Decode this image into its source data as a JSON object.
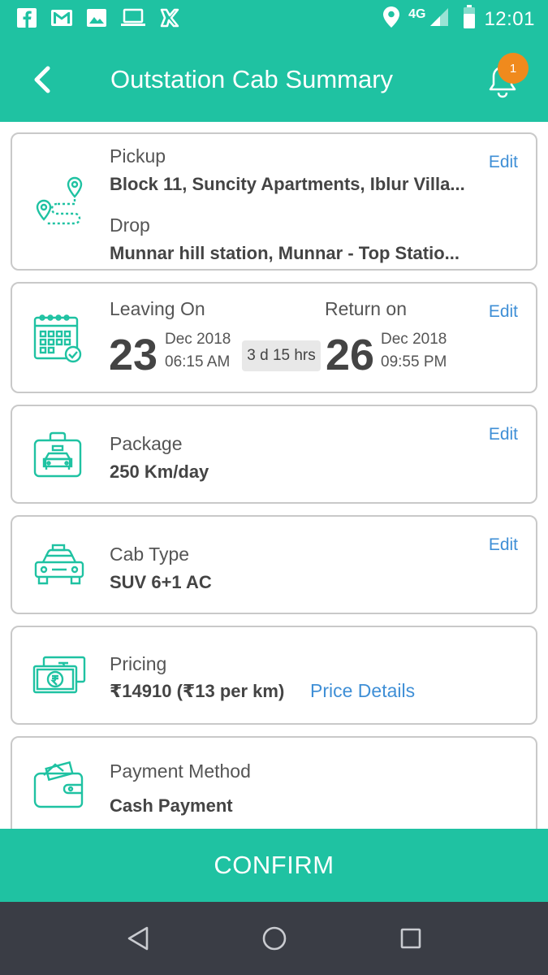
{
  "status_bar": {
    "time": "12:01",
    "network": "4G",
    "icons": [
      "facebook-icon",
      "gmail-icon",
      "gallery-icon",
      "laptop-icon",
      "app-icon",
      "location-icon",
      "signal-icon",
      "battery-icon"
    ]
  },
  "header": {
    "title": "Outstation Cab Summary",
    "notification_count": "1"
  },
  "route": {
    "pickup_label": "Pickup",
    "pickup_value": "Block 11, Suncity Apartments, Iblur Villa...",
    "drop_label": "Drop",
    "drop_value": "Munnar hill station, Munnar - Top Statio...",
    "edit_label": "Edit"
  },
  "dates": {
    "leaving_label": "Leaving On",
    "leaving_day": "23",
    "leaving_month_year": "Dec 2018",
    "leaving_time": "06:15 AM",
    "duration": "3 d 15 hrs",
    "return_label": "Return on",
    "return_day": "26",
    "return_month_year": "Dec 2018",
    "return_time": "09:55 PM",
    "edit_label": "Edit"
  },
  "package": {
    "label": "Package",
    "value": "250 Km/day",
    "edit_label": "Edit"
  },
  "cab_type": {
    "label": "Cab Type",
    "value": "SUV 6+1 AC",
    "edit_label": "Edit"
  },
  "pricing": {
    "label": "Pricing",
    "value": "₹14910 (₹13 per km)",
    "details_link": "Price Details"
  },
  "payment": {
    "label": "Payment Method",
    "value": "Cash Payment"
  },
  "confirm_label": "CONFIRM",
  "colors": {
    "accent": "#1fc2a2",
    "link": "#3f8fd6",
    "badge": "#f08a1d",
    "nav_bar": "#3a3d45"
  }
}
